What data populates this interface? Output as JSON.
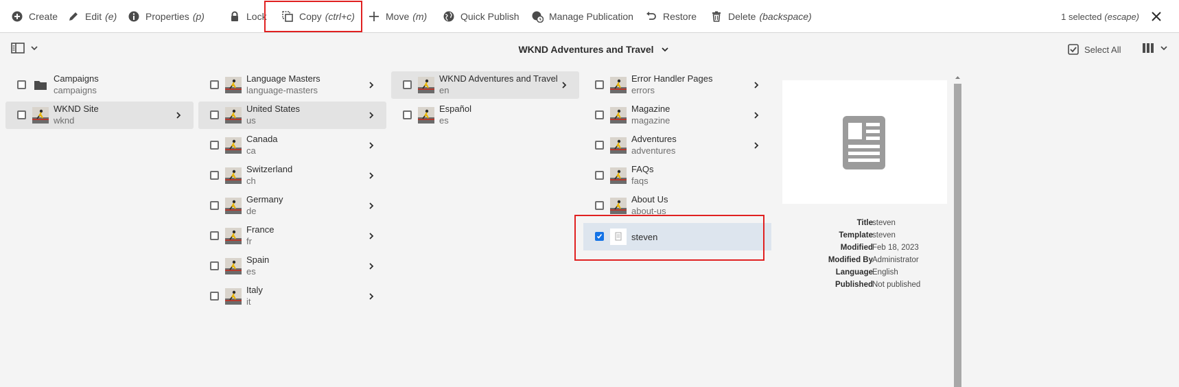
{
  "toolbar": {
    "actions": [
      {
        "label": "Create",
        "shortcut": "",
        "icon": "add-circle-icon"
      },
      {
        "label": "Edit",
        "shortcut": "(e)",
        "icon": "pencil-icon"
      },
      {
        "label": "Properties",
        "shortcut": "(p)",
        "icon": "info-icon"
      },
      {
        "label": "Lock",
        "shortcut": "",
        "icon": "lock-icon"
      },
      {
        "label": "Copy",
        "shortcut": "(ctrl+c)",
        "icon": "copy-icon"
      },
      {
        "label": "Move",
        "shortcut": "(m)",
        "icon": "move-icon"
      },
      {
        "label": "Quick Publish",
        "shortcut": "",
        "icon": "globe-icon"
      },
      {
        "label": "Manage Publication",
        "shortcut": "",
        "icon": "globe-clock-icon"
      },
      {
        "label": "Restore",
        "shortcut": "",
        "icon": "undo-icon"
      },
      {
        "label": "Delete",
        "shortcut": "(backspace)",
        "icon": "trash-icon"
      }
    ],
    "selection_count": "1 selected",
    "selection_escape": "(escape)"
  },
  "subbar": {
    "breadcrumb": "WKND Adventures and Travel",
    "select_all": "Select All"
  },
  "columns": [
    {
      "items": [
        {
          "title": "Campaigns",
          "name": "campaigns",
          "thumb": "folder",
          "has_children": false,
          "active": false
        },
        {
          "title": "WKND Site",
          "name": "wknd",
          "thumb": "photo",
          "has_children": true,
          "active": true
        }
      ]
    },
    {
      "items": [
        {
          "title": "Language Masters",
          "name": "language-masters",
          "thumb": "photo",
          "has_children": true,
          "active": false
        },
        {
          "title": "United States",
          "name": "us",
          "thumb": "photo",
          "has_children": true,
          "active": true
        },
        {
          "title": "Canada",
          "name": "ca",
          "thumb": "photo",
          "has_children": true,
          "active": false
        },
        {
          "title": "Switzerland",
          "name": "ch",
          "thumb": "photo",
          "has_children": true,
          "active": false
        },
        {
          "title": "Germany",
          "name": "de",
          "thumb": "photo",
          "has_children": true,
          "active": false
        },
        {
          "title": "France",
          "name": "fr",
          "thumb": "photo",
          "has_children": true,
          "active": false
        },
        {
          "title": "Spain",
          "name": "es",
          "thumb": "photo",
          "has_children": true,
          "active": false
        },
        {
          "title": "Italy",
          "name": "it",
          "thumb": "photo",
          "has_children": true,
          "active": false
        }
      ]
    },
    {
      "items": [
        {
          "title": "WKND Adventures and Travel",
          "name": "en",
          "thumb": "photo",
          "has_children": true,
          "active": true
        },
        {
          "title": "Español",
          "name": "es",
          "thumb": "photo",
          "has_children": false,
          "active": false
        }
      ]
    },
    {
      "items": [
        {
          "title": "Error Handler Pages",
          "name": "errors",
          "thumb": "photo",
          "has_children": true,
          "active": false
        },
        {
          "title": "Magazine",
          "name": "magazine",
          "thumb": "photo",
          "has_children": true,
          "active": false
        },
        {
          "title": "Adventures",
          "name": "adventures",
          "thumb": "photo",
          "has_children": true,
          "active": false
        },
        {
          "title": "FAQs",
          "name": "faqs",
          "thumb": "photo",
          "has_children": false,
          "active": false
        },
        {
          "title": "About Us",
          "name": "about-us",
          "thumb": "photo",
          "has_children": false,
          "active": false
        }
      ],
      "selected_item": {
        "title": "steven",
        "checked": true,
        "thumb": "page"
      }
    }
  ],
  "details": {
    "rows": [
      {
        "label": "Title",
        "value": "steven"
      },
      {
        "label": "Template",
        "value": "steven"
      },
      {
        "label": "Modified",
        "value": "Feb 18, 2023"
      },
      {
        "label": "Modified By",
        "value": "Administrator"
      },
      {
        "label": "Language",
        "value": "English"
      },
      {
        "label": "Published",
        "value": "Not published"
      }
    ]
  },
  "colors": {
    "accent": "#1473e6",
    "highlight_box": "#e02020",
    "active_row": "#e3e3e3",
    "selected_row": "#dde5ee"
  }
}
